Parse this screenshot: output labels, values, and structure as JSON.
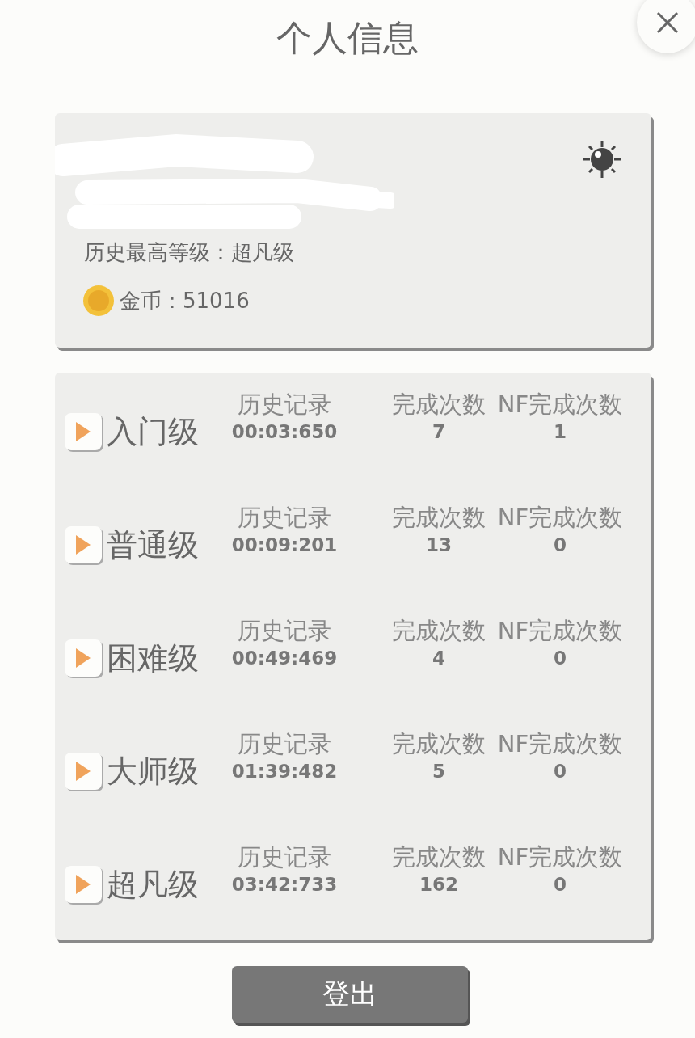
{
  "title": "个人信息",
  "profile": {
    "highest_level": "历史最高等级：超凡级",
    "coins": "金币：51016"
  },
  "levels": [
    {
      "name": "入门级",
      "record_label": "历史记录",
      "record": "00:03:650",
      "count_label": "完成次数",
      "count": "7",
      "nf_label": "NF完成次数",
      "nf_count": "1"
    },
    {
      "name": "普通级",
      "record_label": "历史记录",
      "record": "00:09:201",
      "count_label": "完成次数",
      "count": "13",
      "nf_label": "NF完成次数",
      "nf_count": "0"
    },
    {
      "name": "困难级",
      "record_label": "历史记录",
      "record": "00:49:469",
      "count_label": "完成次数",
      "count": "4",
      "nf_label": "NF完成次数",
      "nf_count": "0"
    },
    {
      "name": "大师级",
      "record_label": "历史记录",
      "record": "01:39:482",
      "count_label": "完成次数",
      "count": "5",
      "nf_label": "NF完成次数",
      "nf_count": "0"
    },
    {
      "name": "超凡级",
      "record_label": "历史记录",
      "record": "03:42:733",
      "count_label": "完成次数",
      "count": "162",
      "nf_label": "NF完成次数",
      "nf_count": "0"
    }
  ],
  "logout_button": "登出"
}
